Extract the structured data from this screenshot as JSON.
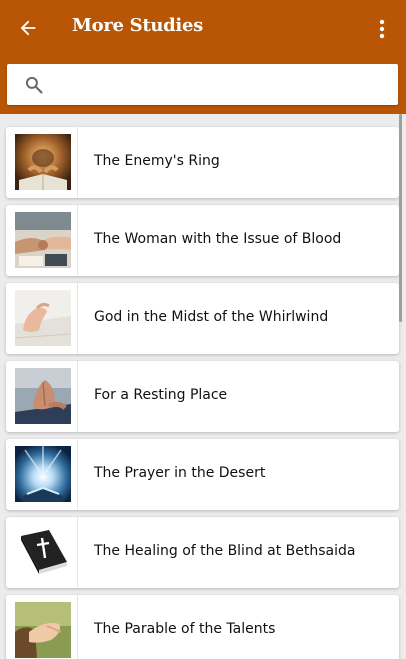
{
  "header": {
    "title": "More Studies",
    "background_color": "#b95606",
    "back_icon": "arrow-left-icon",
    "menu_icon": "more-vertical-icon"
  },
  "search": {
    "placeholder": "",
    "value": "",
    "icon": "search-icon"
  },
  "studies": [
    {
      "label": "The Enemy's Ring",
      "thumbnail": "person-reading-bible-photo"
    },
    {
      "label": "The Woman with the Issue of Blood",
      "thumbnail": "hands-holding-photo"
    },
    {
      "label": "God in the Midst of the Whirlwind",
      "thumbnail": "hand-on-page-photo"
    },
    {
      "label": "For a Resting Place",
      "thumbnail": "praying-hands-photo"
    },
    {
      "label": "The Prayer in the Desert",
      "thumbnail": "light-from-book-photo"
    },
    {
      "label": "The Healing of the Blind at Bethsaida",
      "thumbnail": "holy-bible-book-icon"
    },
    {
      "label": "The Parable of the Talents",
      "thumbnail": "hand-with-bible-photo"
    }
  ]
}
